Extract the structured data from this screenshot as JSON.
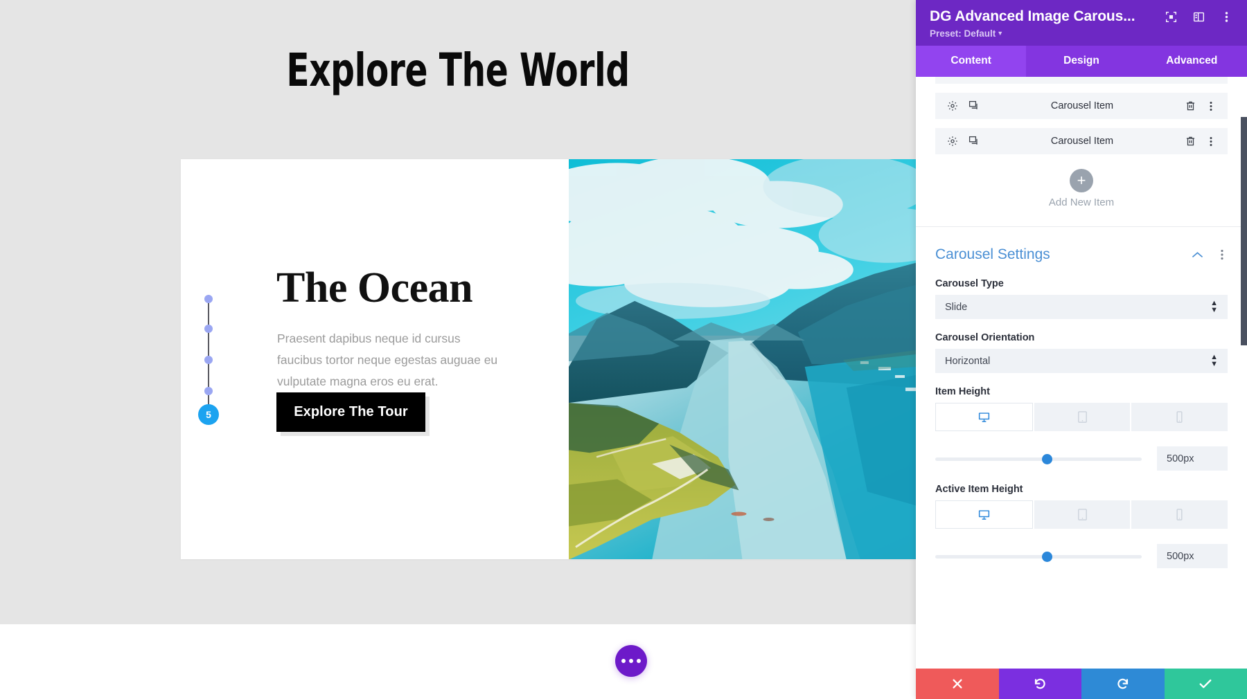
{
  "canvas": {
    "hero_title": "Explore The World",
    "slide": {
      "heading": "The Ocean",
      "body": "Praesent dapibus neque id cursus faucibus tortor neque egestas auguae eu vulputate magna eros eu erat.",
      "button_label": "Explore The Tour",
      "image_alt": "fjord-landscape-photo"
    },
    "rail": {
      "badge": "5",
      "dot_count": 4
    },
    "fab": {
      "name": "page-settings-ellipsis",
      "color": "#6d1ac9"
    }
  },
  "panel": {
    "title": "DG Advanced Image Carous...",
    "preset_label": "Preset: Default",
    "header_icons": [
      "focus-icon",
      "panel-layout-icon",
      "kebab-menu-icon"
    ],
    "tabs": [
      {
        "label": "Content",
        "active": true
      },
      {
        "label": "Design",
        "active": false
      },
      {
        "label": "Advanced",
        "active": false
      }
    ],
    "items": [
      {
        "label": "Carousel Item"
      },
      {
        "label": "Carousel Item"
      }
    ],
    "add_new": {
      "icon": "+",
      "label": "Add New Item"
    },
    "group": {
      "title": "Carousel Settings",
      "collapse_icon": "chevron-up-icon",
      "menu_icon": "kebab-menu-icon",
      "fields": [
        {
          "type": "select",
          "label": "Carousel Type",
          "value": "Slide"
        },
        {
          "type": "select",
          "label": "Carousel Orientation",
          "value": "Horizontal"
        },
        {
          "type": "slider",
          "label": "Item Height",
          "value": "500px",
          "slider_percent": 50,
          "devices": [
            {
              "name": "desktop-icon",
              "active": true
            },
            {
              "name": "tablet-icon",
              "active": false
            },
            {
              "name": "mobile-icon",
              "active": false
            }
          ]
        },
        {
          "type": "slider",
          "label": "Active Item Height",
          "value": "500px",
          "slider_percent": 50,
          "devices": [
            {
              "name": "desktop-icon",
              "active": true
            },
            {
              "name": "tablet-icon",
              "active": false
            },
            {
              "name": "mobile-icon",
              "active": false
            }
          ]
        }
      ]
    },
    "actions": [
      {
        "name": "cancel-button",
        "icon": "close-icon",
        "color": "#ef5a5a"
      },
      {
        "name": "undo-button",
        "icon": "undo-icon",
        "color": "#7b2fe0"
      },
      {
        "name": "redo-button",
        "icon": "redo-icon",
        "color": "#2e8ad6"
      },
      {
        "name": "save-button",
        "icon": "check-icon",
        "color": "#2fc79b"
      }
    ],
    "colors": {
      "header": "#6d28c4",
      "tabbar": "#8335e0",
      "tab_active": "#9244ef",
      "group_title": "#4a8fd4",
      "accent_blue": "#2b87da"
    }
  }
}
